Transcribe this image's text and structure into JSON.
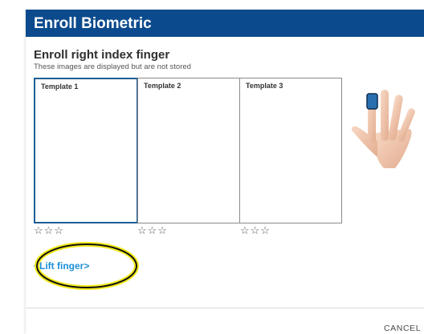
{
  "dialog": {
    "title": "Enroll Biometric",
    "heading": "Enroll right index finger",
    "subheading": "These images are displayed but are not stored",
    "cancel_label": "CANCEL"
  },
  "templates": [
    {
      "label": "Template 1",
      "active": true,
      "stars": "☆☆☆"
    },
    {
      "label": "Template 2",
      "active": false,
      "stars": "☆☆☆"
    },
    {
      "label": "Template 3",
      "active": false,
      "stars": "☆☆☆"
    }
  ],
  "status": {
    "text": "<Lift finger>"
  },
  "hand_illustration": {
    "highlighted_finger": "index",
    "icon": "hand-icon"
  },
  "annotation": {
    "shape": "ellipse",
    "color": "#f2ea1c",
    "target": "status"
  },
  "colors": {
    "title_bar": "#0b4a8c",
    "status_text": "#1c8fd8",
    "active_template_border": "#1f5c94",
    "finger_highlight": "#2a6fb0"
  }
}
